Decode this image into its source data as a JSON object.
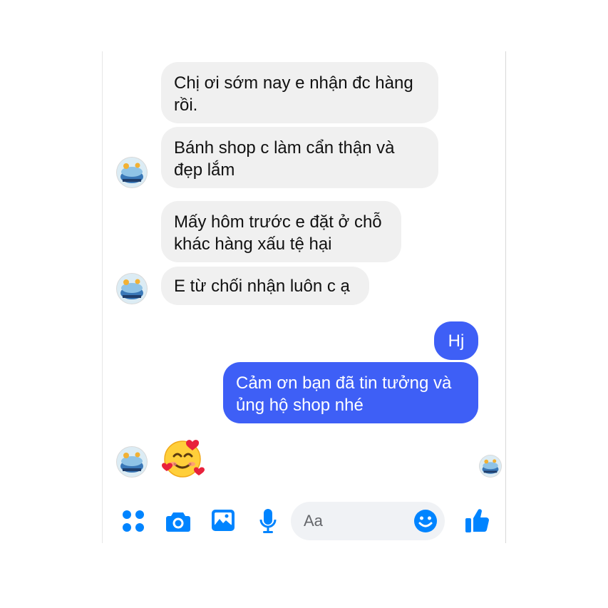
{
  "colors": {
    "accent": "#0084ff",
    "outgoing_bubble": "#3e5ff6",
    "incoming_bubble": "#f0f0f0"
  },
  "messages": {
    "incoming": [
      {
        "lines": [
          "Chị ơi sớm nay e nhận đc hàng",
          "rồi."
        ]
      },
      {
        "lines": [
          "Bánh shop c làm cẩn thận và",
          "đẹp lắm"
        ]
      },
      {
        "lines": [
          "Mấy hôm trước e đặt ở chỗ",
          "khác hàng xấu tệ hại"
        ]
      },
      {
        "lines": [
          "E từ chối nhận luôn c ạ"
        ]
      }
    ],
    "outgoing": [
      {
        "lines": [
          "Hj"
        ]
      },
      {
        "lines": [
          "Cảm ơn bạn đã tin tưởng và",
          "ủng hộ shop nhé"
        ]
      }
    ],
    "reaction_emoji": "smiling-face-with-hearts"
  },
  "composer": {
    "placeholder": "Aa",
    "icons": [
      "more-apps-icon",
      "camera-icon",
      "image-icon",
      "microphone-icon",
      "emoji-icon",
      "thumbs-up-icon"
    ]
  }
}
